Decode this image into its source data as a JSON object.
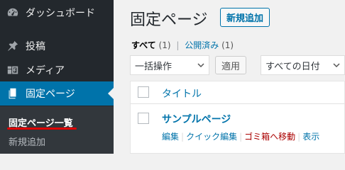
{
  "sidebar": {
    "items": [
      {
        "label": "ダッシュボード",
        "icon": "dashboard-icon"
      },
      {
        "label": "投稿",
        "icon": "pin-icon"
      },
      {
        "label": "メディア",
        "icon": "media-icon"
      },
      {
        "label": "固定ページ",
        "icon": "pages-icon"
      }
    ],
    "submenu": [
      {
        "label": "固定ページ一覧"
      },
      {
        "label": "新規追加"
      }
    ],
    "colors": {
      "background": "#23282d",
      "active": "#0073aa",
      "highlight_underline": "#e00000"
    }
  },
  "main": {
    "title": "固定ページ",
    "add_new": "新規追加",
    "filters": {
      "all_label": "すべて",
      "all_count": "(1)",
      "separator": "|",
      "published_label": "公開済み",
      "published_count": "(1)"
    },
    "bulk_action": {
      "selected": "一括操作"
    },
    "apply": "適用",
    "date_filter": {
      "selected": "すべての日付"
    },
    "table": {
      "column_title": "タイトル",
      "rows": [
        {
          "title": "サンプルページ",
          "actions": {
            "edit": "編集",
            "quick_edit": "クイック編集",
            "trash": "ゴミ箱へ移動",
            "view": "表示"
          }
        }
      ]
    }
  }
}
